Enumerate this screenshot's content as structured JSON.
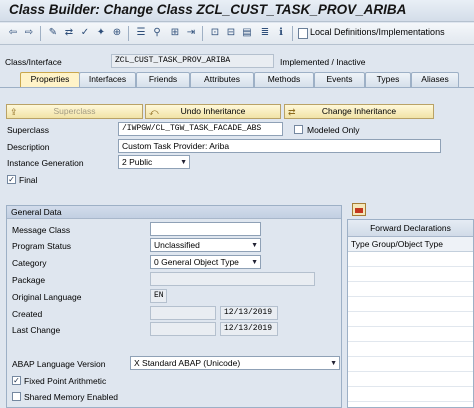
{
  "window": {
    "title": "Class Builder: Change Class ZCL_CUST_TASK_PROV_ARIBA"
  },
  "toolbar": {
    "icons": [
      "back-icon",
      "forward-icon",
      "display-change-icon",
      "where-used-icon",
      "activate-icon",
      "check-icon",
      "object-list-icon",
      "navigate-icon",
      "hierarchy-icon",
      "test-icon",
      "help-icon",
      "info-icon",
      "local-definitions-icon"
    ],
    "local_definitions_label": "Local Definitions/Implementations"
  },
  "header": {
    "class_label": "Class/Interface",
    "class_value": "ZCL_CUST_TASK_PROV_ARIBA",
    "status": "Implemented / Inactive"
  },
  "tabs": [
    "Properties",
    "Interfaces",
    "Friends",
    "Attributes",
    "Methods",
    "Events",
    "Types",
    "Aliases"
  ],
  "active_tab": "Properties",
  "buttons": {
    "superclass": "Superclass",
    "undo_inheritance": "Undo Inheritance",
    "change_inheritance": "Change Inheritance"
  },
  "properties": {
    "superclass_label": "Superclass",
    "superclass_value": "/IWPGW/CL_TGW_TASK_FACADE_ABS",
    "modeled_only_label": "Modeled Only",
    "modeled_only_checked": false,
    "description_label": "Description",
    "description_value": "Custom Task Provider: Ariba",
    "instance_generation_label": "Instance Generation",
    "instance_generation_value": "2 Public",
    "final_label": "Final",
    "final_checked": true
  },
  "general_data": {
    "title": "General Data",
    "message_class_label": "Message Class",
    "message_class_value": "",
    "program_status_label": "Program Status",
    "program_status_value": "Unclassified",
    "category_label": "Category",
    "category_value": "0 General Object Type",
    "package_label": "Package",
    "package_value": "",
    "original_language_label": "Original Language",
    "original_language_value": "EN",
    "created_label": "Created",
    "created_value": "12/13/2019",
    "last_change_label": "Last Change",
    "last_change_value": "12/13/2019",
    "abap_version_label": "ABAP Language Version",
    "abap_version_value": "X Standard ABAP (Unicode)",
    "fixed_point_label": "Fixed Point Arithmetic",
    "fixed_point_checked": true,
    "shared_memory_label": "Shared Memory Enabled",
    "shared_memory_checked": false
  },
  "forward_declarations": {
    "title": "Forward Declarations",
    "column": "Type Group/Object Type"
  }
}
